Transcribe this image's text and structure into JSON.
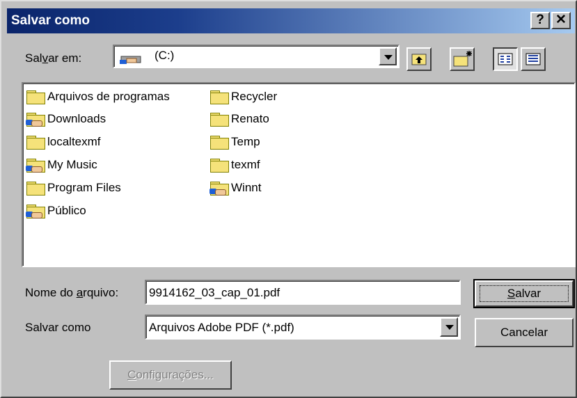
{
  "window": {
    "title": "Salvar como",
    "help_btn": "?",
    "close_btn": "✕"
  },
  "location": {
    "label": "Salvar em:",
    "label_pre": "Sal",
    "label_u": "v",
    "label_post": "ar em:",
    "value": "(C:)"
  },
  "files": [
    {
      "name": "Arquivos de programas",
      "icon": "folder-icon"
    },
    {
      "name": "Downloads",
      "icon": "shared-folder-icon"
    },
    {
      "name": "localtexmf",
      "icon": "folder-icon"
    },
    {
      "name": "My Music",
      "icon": "shared-folder-icon"
    },
    {
      "name": "Program Files",
      "icon": "folder-icon"
    },
    {
      "name": "Público",
      "icon": "shared-folder-icon"
    },
    {
      "name": "Recycler",
      "icon": "folder-icon"
    },
    {
      "name": "Renato",
      "icon": "folder-icon"
    },
    {
      "name": "Temp",
      "icon": "folder-icon"
    },
    {
      "name": "texmf",
      "icon": "folder-icon"
    },
    {
      "name": "Winnt",
      "icon": "shared-folder-icon"
    }
  ],
  "filename": {
    "label_pre": "Nome do ",
    "label_u": "a",
    "label_post": "rquivo:",
    "value": "9914162_03_cap_01.pdf"
  },
  "filetype": {
    "label": "Salvar como",
    "value": "Arquivos Adobe PDF (*.pdf)"
  },
  "buttons": {
    "save_u": "S",
    "save_rest": "alvar",
    "cancel": "Cancelar",
    "settings_u": "C",
    "settings_rest": "onfigurações..."
  }
}
